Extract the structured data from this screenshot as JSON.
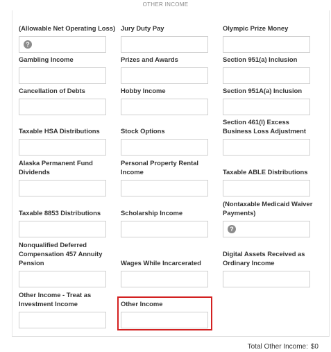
{
  "section_title": "OTHER INCOME",
  "help_icon_glyph": "?",
  "fields": [
    {
      "id": "allowable-nol",
      "label": "(Allowable Net Operating Loss)",
      "value": "",
      "icon": "help-icon"
    },
    {
      "id": "jury-duty-pay",
      "label": "Jury Duty Pay",
      "value": ""
    },
    {
      "id": "olympic-prize-money",
      "label": "Olympic Prize Money",
      "value": ""
    },
    {
      "id": "gambling-income",
      "label": "Gambling Income",
      "value": ""
    },
    {
      "id": "prizes-and-awards",
      "label": "Prizes and Awards",
      "value": ""
    },
    {
      "id": "section-951a-inclusion",
      "label": "Section 951(a) Inclusion",
      "value": ""
    },
    {
      "id": "cancellation-of-debts",
      "label": "Cancellation of Debts",
      "value": ""
    },
    {
      "id": "hobby-income",
      "label": "Hobby Income",
      "value": ""
    },
    {
      "id": "section-951A-inclusion",
      "label": "Section 951A(a) Inclusion",
      "value": ""
    },
    {
      "id": "taxable-hsa-distributions",
      "label": "Taxable HSA Distributions",
      "value": ""
    },
    {
      "id": "stock-options",
      "label": "Stock Options",
      "value": ""
    },
    {
      "id": "section-461l-excess-loss",
      "label": "Section 461(l) Excess Business Loss Adjustment",
      "value": ""
    },
    {
      "id": "alaska-pfd",
      "label": "Alaska Permanent Fund Dividends",
      "value": ""
    },
    {
      "id": "personal-property-rental",
      "label": "Personal Property Rental Income",
      "value": ""
    },
    {
      "id": "taxable-able-distributions",
      "label": "Taxable ABLE Distributions",
      "value": ""
    },
    {
      "id": "taxable-8853-distributions",
      "label": "Taxable 8853 Distributions",
      "value": ""
    },
    {
      "id": "scholarship-income",
      "label": "Scholarship Income",
      "value": ""
    },
    {
      "id": "nontaxable-medicaid-waiver",
      "label": "(Nontaxable Medicaid Waiver Payments)",
      "value": "",
      "icon": "help-icon"
    },
    {
      "id": "nonqualified-deferred-comp",
      "label": "Nonqualified Deferred Compensation 457 Annuity Pension",
      "value": ""
    },
    {
      "id": "wages-while-incarcerated",
      "label": "Wages While Incarcerated",
      "value": ""
    },
    {
      "id": "digital-assets-ordinary-income",
      "label": "Digital Assets Received as Ordinary Income",
      "value": ""
    },
    {
      "id": "other-income-investment",
      "label": "Other Income - Treat as Investment Income",
      "value": ""
    },
    {
      "id": "other-income",
      "label": "Other Income",
      "value": "",
      "highlighted": true
    }
  ],
  "total": {
    "label": "Total Other Income:",
    "value": "$0"
  },
  "colors": {
    "highlight": "#d32020",
    "help_icon": "#8c8c8c",
    "title": "#8a8a8a"
  }
}
